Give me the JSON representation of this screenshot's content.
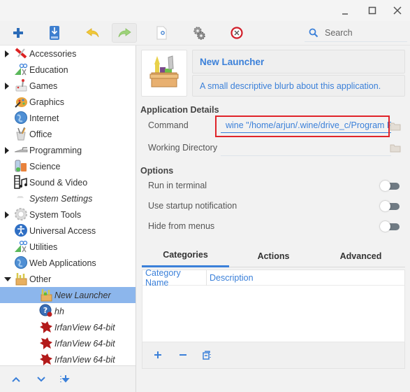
{
  "window": {
    "controls": [
      {
        "name": "minimize",
        "glyph": "_"
      },
      {
        "name": "maximize",
        "glyph": "☐"
      },
      {
        "name": "close",
        "glyph": "✕"
      }
    ]
  },
  "toolbar": {
    "buttons": [
      {
        "name": "add-launcher",
        "icon": "plus-icon"
      },
      {
        "name": "save",
        "icon": "save-icon"
      },
      {
        "name": "undo",
        "icon": "undo-icon"
      },
      {
        "name": "redo",
        "icon": "redo-icon"
      },
      {
        "name": "revert",
        "icon": "revert-icon"
      },
      {
        "name": "preferences",
        "icon": "gears-icon"
      },
      {
        "name": "delete",
        "icon": "delete-icon"
      }
    ],
    "search_placeholder": "Search"
  },
  "sidebar": {
    "items": [
      {
        "label": "Accessories",
        "icon": "accessories-icon",
        "expandable": true,
        "italic": false
      },
      {
        "label": "Education",
        "icon": "education-icon",
        "expandable": false,
        "italic": false
      },
      {
        "label": "Games",
        "icon": "games-icon",
        "expandable": true,
        "italic": false
      },
      {
        "label": "Graphics",
        "icon": "graphics-icon",
        "expandable": false,
        "italic": false
      },
      {
        "label": "Internet",
        "icon": "internet-icon",
        "expandable": false,
        "italic": false
      },
      {
        "label": "Office",
        "icon": "office-icon",
        "expandable": false,
        "italic": false
      },
      {
        "label": "Programming",
        "icon": "programming-icon",
        "expandable": true,
        "italic": false
      },
      {
        "label": "Science",
        "icon": "science-icon",
        "expandable": false,
        "italic": false
      },
      {
        "label": "Sound & Video",
        "icon": "sound-video-icon",
        "expandable": false,
        "italic": false
      },
      {
        "label": "System Settings",
        "icon": "system-settings-icon",
        "expandable": false,
        "italic": true
      },
      {
        "label": "System Tools",
        "icon": "system-tools-icon",
        "expandable": true,
        "italic": false
      },
      {
        "label": "Universal Access",
        "icon": "universal-access-icon",
        "expandable": false,
        "italic": false
      },
      {
        "label": "Utilities",
        "icon": "utilities-icon",
        "expandable": false,
        "italic": false
      },
      {
        "label": "Web Applications",
        "icon": "web-applications-icon",
        "expandable": false,
        "italic": false
      },
      {
        "label": "Other",
        "icon": "other-icon",
        "expandable": true,
        "expanded": true,
        "italic": false
      }
    ],
    "children": [
      {
        "label": "New Launcher",
        "icon": "launcher-icon",
        "italic": true,
        "selected": true
      },
      {
        "label": "hh",
        "icon": "wine-help-icon",
        "italic": true,
        "selected": false
      },
      {
        "label": "IrfanView 64-bit",
        "icon": "irfanview-icon",
        "italic": true,
        "selected": false
      },
      {
        "label": "IrfanView 64-bit",
        "icon": "irfanview-icon",
        "italic": true,
        "selected": false
      },
      {
        "label": "IrfanView 64-bit",
        "icon": "irfanview-icon",
        "italic": true,
        "selected": false
      }
    ],
    "footer": [
      {
        "name": "move-up",
        "icon": "chevron-up-icon"
      },
      {
        "name": "move-down",
        "icon": "chevron-down-icon"
      },
      {
        "name": "sort",
        "icon": "sort-icon"
      }
    ]
  },
  "main": {
    "app_name": "New Launcher",
    "app_description": "A small descriptive blurb about this application.",
    "details_title": "Application Details",
    "command_label": "Command",
    "command_value": "wine \"/home/arjun/.wine/drive_c/Program Fi",
    "working_dir_label": "Working Directory",
    "working_dir_value": "",
    "options_title": "Options",
    "options": [
      {
        "label": "Run in terminal",
        "enabled": false
      },
      {
        "label": "Use startup notification",
        "enabled": false
      },
      {
        "label": "Hide from menus",
        "enabled": false
      }
    ],
    "tabs": [
      {
        "label": "Categories",
        "active": true
      },
      {
        "label": "Actions",
        "active": false
      },
      {
        "label": "Advanced",
        "active": false
      }
    ],
    "categories_table": {
      "columns": [
        "Category Name",
        "Description"
      ],
      "rows": []
    },
    "categories_footer": [
      {
        "name": "add-category",
        "icon": "plus-icon"
      },
      {
        "name": "remove-category",
        "icon": "minus-icon"
      },
      {
        "name": "clear-categories",
        "icon": "clear-icon"
      }
    ],
    "colors": {
      "accent": "#3b80d9",
      "selection": "#8cb6ec",
      "highlight_border": "#e0242a"
    }
  }
}
